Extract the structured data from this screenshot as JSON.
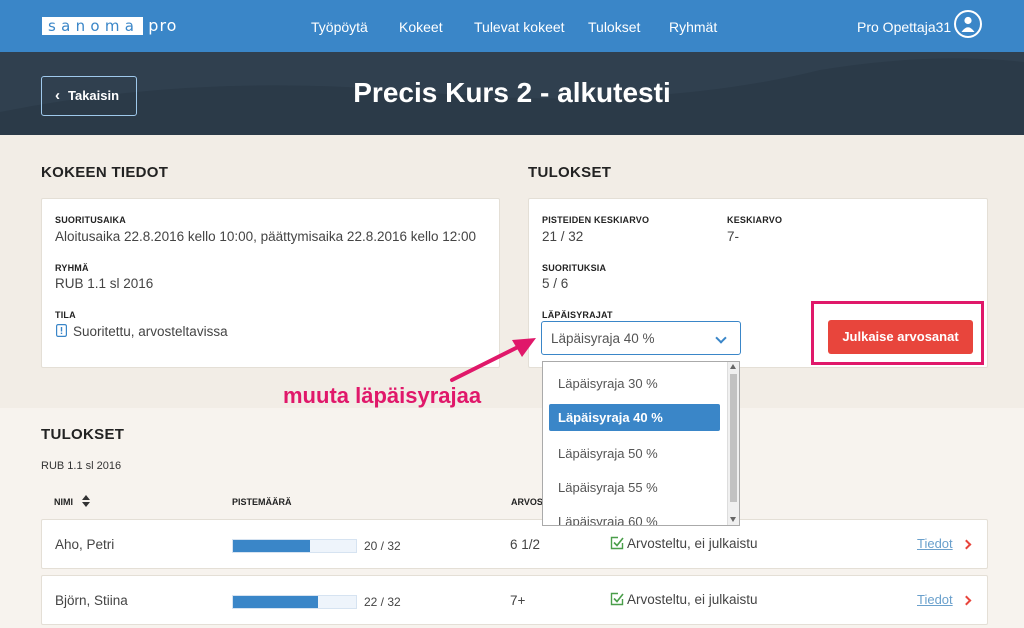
{
  "nav": {
    "logo_main": "sanoma",
    "logo_sub": "pro",
    "links": [
      "Työpöytä",
      "Kokeet",
      "Tulevat kokeet",
      "Tulokset",
      "Ryhmät"
    ],
    "user": "Pro Opettaja31"
  },
  "header": {
    "back_label": "Takaisin",
    "title": "Precis Kurs 2 - alkutesti"
  },
  "exam_info": {
    "heading": "KOKEEN TIEDOT",
    "time_label": "SUORITUSAIKA",
    "time_value": "Aloitusaika 22.8.2016 kello 10:00, päättymisaika 22.8.2016 kello 12:00",
    "group_label": "RYHMÄ",
    "group_value": "RUB 1.1 sl 2016",
    "status_label": "TILA",
    "status_value": "Suoritettu, arvosteltavissa"
  },
  "results_summary": {
    "heading": "TULOKSET",
    "points_avg_label": "PISTEIDEN KESKIARVO",
    "points_avg_value": "21 / 32",
    "avg_label": "KESKIARVO",
    "avg_value": "7-",
    "submissions_label": "SUORITUKSIA",
    "submissions_value": "5 / 6",
    "threshold_label": "LÄPÄISYRAJAT",
    "threshold_selected": "Läpäisyraja 40 %",
    "publish_label": "Julkaise arvosanat",
    "threshold_options": [
      "Läpäisyraja 30 %",
      "Läpäisyraja 40 %",
      "Läpäisyraja 50 %",
      "Läpäisyraja 55 %",
      "Läpäisyraja 60 %"
    ],
    "selected_index": 1
  },
  "annotation": "muuta läpäisyrajaa",
  "results": {
    "heading": "TULOKSET",
    "group": "RUB 1.1 sl 2016",
    "col_name": "NIMI",
    "col_points": "PISTEMÄÄRÄ",
    "col_grade": "ARVOS",
    "rows": [
      {
        "name": "Aho, Petri",
        "score": "20 / 32",
        "fraction": 0.625,
        "grade": "6 1/2",
        "status": "Arvosteltu, ei julkaistu",
        "link": "Tiedot"
      },
      {
        "name": "Björn, Stiina",
        "score": "22 / 32",
        "fraction": 0.6875,
        "grade": "7+",
        "status": "Arvosteltu, ei julkaistu",
        "link": "Tiedot"
      }
    ]
  },
  "colors": {
    "primary": "#3a86c8",
    "header_dark": "#30404f",
    "publish": "#e8453c",
    "annotation": "#e0186a"
  }
}
